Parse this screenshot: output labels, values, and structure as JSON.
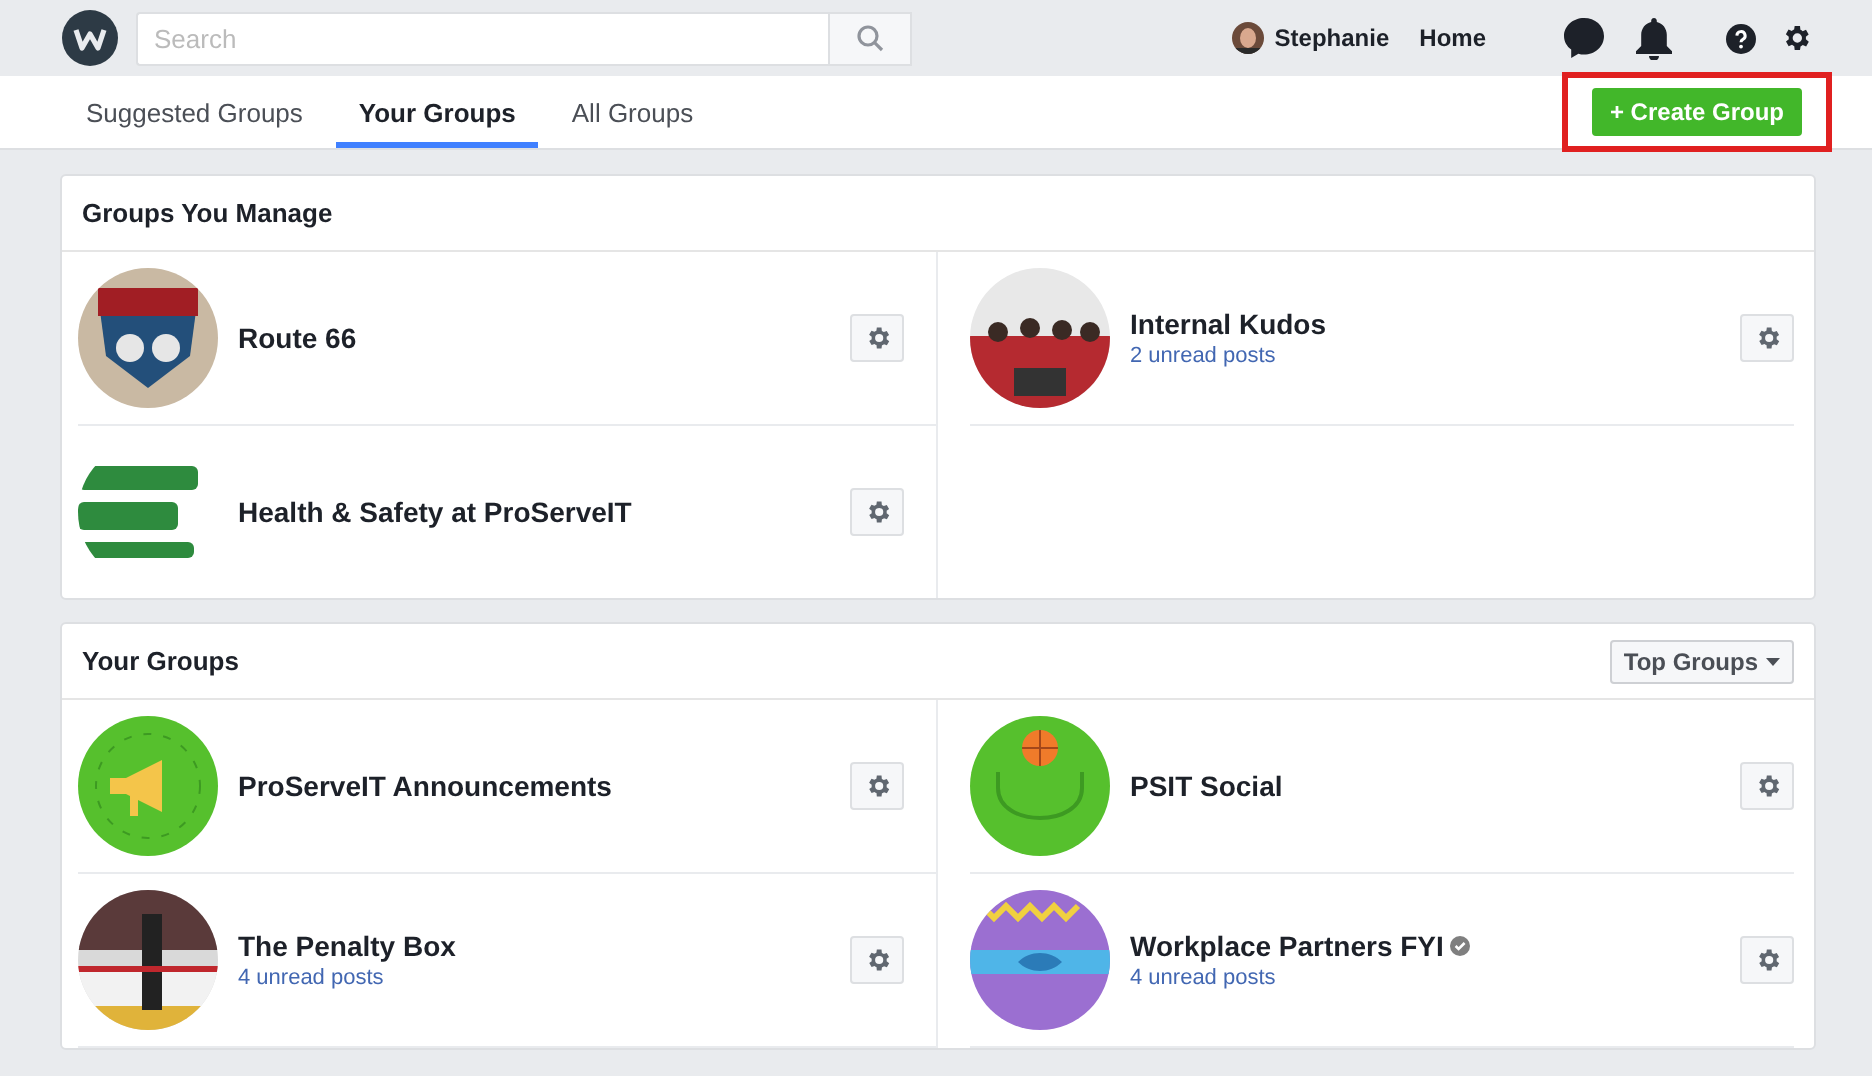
{
  "topbar": {
    "search": {
      "placeholder": "Search"
    },
    "user": {
      "name": "Stephanie"
    },
    "home_link": "Home"
  },
  "tabs": [
    {
      "label": "Suggested Groups",
      "selected": false
    },
    {
      "label": "Your Groups",
      "selected": true
    },
    {
      "label": "All Groups",
      "selected": false
    }
  ],
  "create_button": {
    "label": "+ Create Group",
    "highlighted": true
  },
  "sections": [
    {
      "title": "Groups You Manage",
      "groups": [
        {
          "name": "Route 66",
          "verified": false
        },
        {
          "name": "Internal Kudos",
          "unread": "2 unread posts",
          "verified": false
        },
        {
          "name": "Health & Safety at ProServeIT",
          "verified": false
        }
      ]
    },
    {
      "title": "Your Groups",
      "sort": {
        "label": "Top Groups"
      },
      "groups": [
        {
          "name": "ProServeIT Announcements",
          "verified": false
        },
        {
          "name": "PSIT Social",
          "verified": false
        },
        {
          "name": "The Penalty Box",
          "unread": "4 unread posts",
          "verified": false
        },
        {
          "name": "Workplace Partners FYI",
          "unread": "4 unread posts",
          "verified": true
        }
      ]
    }
  ]
}
